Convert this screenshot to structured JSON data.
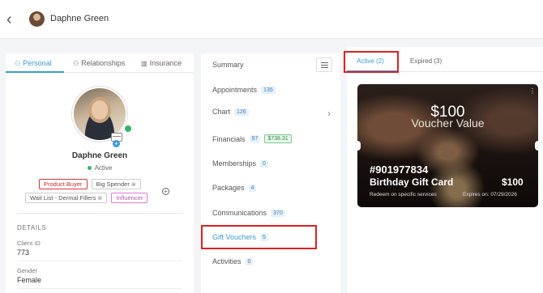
{
  "header": {
    "back_icon": "chevron-left-icon",
    "back_glyph": "‹",
    "client_name": "Daphne Green"
  },
  "left_panel": {
    "tabs": [
      {
        "label": "Personal",
        "icon": "user-icon",
        "glyph": "⚇"
      },
      {
        "label": "Relationships",
        "icon": "relationships-icon",
        "glyph": "⚇"
      },
      {
        "label": "Insurance",
        "icon": "building-icon",
        "glyph": "▥"
      }
    ],
    "profile": {
      "name": "Daphne Green",
      "status": "Active",
      "status_color": "#37b36b",
      "plus_glyph": "+"
    },
    "tags": [
      {
        "label": "Product Buyer",
        "color": "#d23a3a"
      },
      {
        "label": "Big Spender",
        "removable": true
      },
      {
        "label": "Wait List - Dermal Fillers",
        "removable": true
      },
      {
        "label": "Influencer",
        "color": "#e27ad8"
      }
    ],
    "remove_glyph": "⊗",
    "add_tag_glyph": "+",
    "details": {
      "heading": "DETAILS",
      "fields": [
        {
          "label": "Client ID",
          "value": "773"
        },
        {
          "label": "Gender",
          "value": "Female"
        }
      ]
    }
  },
  "middle_nav": {
    "items": [
      {
        "label": "Summary"
      },
      {
        "label": "Appointments",
        "count": "135"
      },
      {
        "label": "Chart",
        "count": "126"
      },
      {
        "label": "Financials",
        "count": "97",
        "amount": "$738.31"
      },
      {
        "label": "Memberships",
        "count": "0"
      },
      {
        "label": "Packages",
        "count": "4"
      },
      {
        "label": "Communications",
        "count": "370"
      },
      {
        "label": "Gift Vouchers",
        "count": "5"
      },
      {
        "label": "Activities",
        "count": "0"
      }
    ],
    "chevron_glyph": "›"
  },
  "right_panel": {
    "tabs": [
      {
        "label": "Active (2)"
      },
      {
        "label": "Expired (3)"
      }
    ],
    "voucher": {
      "amount": "$100",
      "value_label": "Voucher Value",
      "code": "#901977834",
      "title": "Birthday Gift Card",
      "price": "$100",
      "redeem_text": "Redeem on specific services",
      "expires_text": "Expires on: 07/29/2026",
      "menu_glyph": "⋮"
    }
  },
  "colors": {
    "accent": "#3b9bd6",
    "highlight": "#e02020"
  }
}
